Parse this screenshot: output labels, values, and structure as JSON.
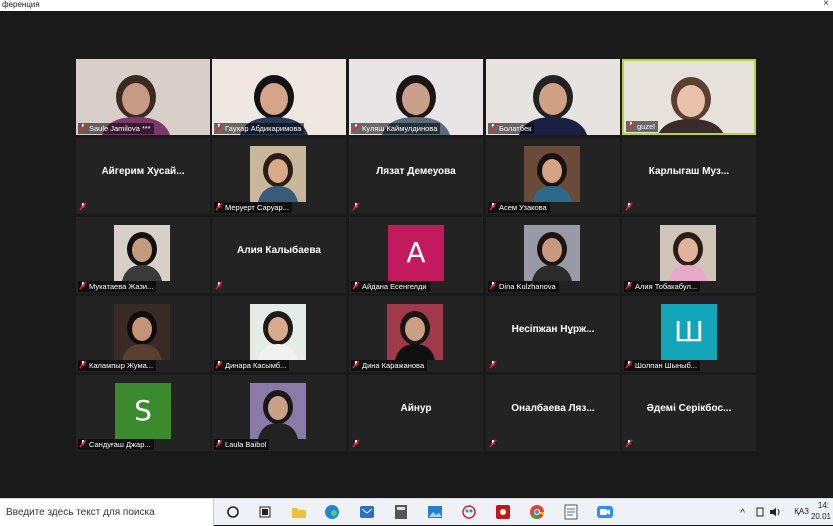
{
  "window": {
    "title": "ференция",
    "close_glyph": "×"
  },
  "participants": [
    {
      "name": "Saule Jamilova ***",
      "view": "video",
      "label_bg": true
    },
    {
      "name": "Гаухар Абдикаримова",
      "view": "video",
      "label_bg": true
    },
    {
      "name": "Куляш Каймулдинова",
      "view": "video",
      "label_bg": true
    },
    {
      "name": "Болатбек",
      "view": "video",
      "label_bg": true
    },
    {
      "name": "guzel",
      "view": "video",
      "label_bg": true,
      "active_speaker": true
    },
    {
      "name": "Айгерим Хусайнова",
      "center_text": "Айгерим  Хусай...",
      "view": "name"
    },
    {
      "name": "Меруерт Саруар...",
      "view": "photo"
    },
    {
      "name": "Лязат Демеуова",
      "center_text": "Лязат Демеуова",
      "view": "name"
    },
    {
      "name": "Асем Узакова",
      "view": "photo"
    },
    {
      "name": "Карлыгаш Музарова",
      "center_text": "Карлыгаш  Муз...",
      "view": "name"
    },
    {
      "name": "Мукатаева Жази...",
      "view": "photo"
    },
    {
      "name": "Алия Калыбаева",
      "center_text": "Алия Калыбаева",
      "view": "name"
    },
    {
      "name": "Айдана Есенгелди",
      "view": "letter",
      "letter": "A",
      "color": "#c3195d"
    },
    {
      "name": "Dina Kulzhanova",
      "view": "photo"
    },
    {
      "name": "Алия Тобакабул...",
      "view": "photo"
    },
    {
      "name": "Калампыр Жума...",
      "view": "photo"
    },
    {
      "name": "Динара Касымб...",
      "view": "photo"
    },
    {
      "name": "Дина Каражанова",
      "view": "photo"
    },
    {
      "name": "Несіпжан Нұржанова",
      "center_text": "Несіпжан  Нұрж...",
      "view": "name"
    },
    {
      "name": "Шолпан Шыныб...",
      "view": "letter",
      "letter": "Ш",
      "color": "#11a5b7"
    },
    {
      "name": "Сандуғаш Джар...",
      "view": "letter",
      "letter": "S",
      "color": "#3c8a2e"
    },
    {
      "name": "Laula Baibol",
      "view": "photo"
    },
    {
      "name": "Айнур",
      "center_text": "Айнур",
      "view": "name"
    },
    {
      "name": "Оналбаева Лязат",
      "center_text": "Оналбаева  Ляз...",
      "view": "name"
    },
    {
      "name": "Әдемі Серікбосынова",
      "center_text": "Әдемі Серікбос...",
      "view": "name"
    }
  ],
  "taskbar": {
    "search_placeholder": "Введите здесь текст для поиска",
    "icons": [
      "start-search-circle-icon",
      "task-view-icon",
      "file-explorer-icon",
      "edge-icon",
      "mail-icon",
      "calculator-icon",
      "photos-icon",
      "paint-icon",
      "red-app-icon",
      "chrome-icon",
      "document-icon",
      "zoom-icon"
    ],
    "tray": {
      "chevron": "^",
      "lang": "ҚАЗ",
      "time": "14:",
      "date": "20.01"
    }
  }
}
